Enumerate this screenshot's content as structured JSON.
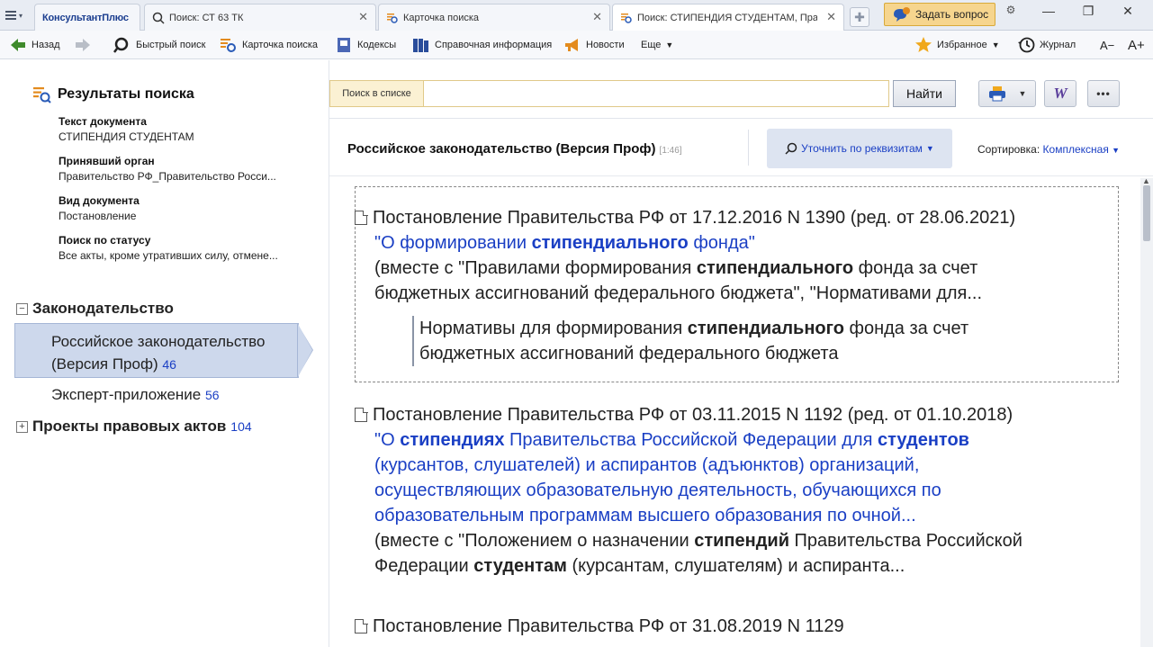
{
  "app": {
    "logo": "КонсультантПлюс"
  },
  "tabs": [
    {
      "label": "Поиск: СТ 63 ТК"
    },
    {
      "label": "Карточка поиска"
    },
    {
      "label": "Поиск: СТИПЕНДИЯ СТУДЕНТАМ, Прави"
    }
  ],
  "ask_button": "Задать вопрос",
  "toolbar": {
    "back": "Назад",
    "quick_search": "Быстрый поиск",
    "search_card": "Карточка поиска",
    "codes": "Кодексы",
    "reference": "Справочная информация",
    "news": "Новости",
    "more": "Еще",
    "favorites": "Избранное",
    "journal": "Журнал",
    "font_smaller": "A−",
    "font_larger": "A+"
  },
  "left": {
    "title": "Результаты поиска",
    "criteria": [
      {
        "key": "Текст документа",
        "value": "СТИПЕНДИЯ СТУДЕНТАМ"
      },
      {
        "key": "Принявший орган",
        "value": "Правительство РФ_Правительство Росси..."
      },
      {
        "key": "Вид документа",
        "value": "Постановление"
      },
      {
        "key": "Поиск по статусу",
        "value": "Все акты, кроме утративших силу, отмене..."
      }
    ],
    "tree": {
      "legislation": "Законодательство",
      "selected_label": "Российское законодательство (Версия Проф)",
      "selected_count": "46",
      "expert_label": "Эксперт-приложение",
      "expert_count": "56",
      "projects_label": "Проекты правовых актов",
      "projects_count": "104"
    }
  },
  "search": {
    "label": "Поиск в списке",
    "value": "",
    "placeholder": "",
    "button": "Найти"
  },
  "results": {
    "header_title": "Российское законодательство (Версия Проф)",
    "header_range": "[1:46]",
    "refine_button": "Уточнить по реквизитам",
    "sort_label": "Сортировка:",
    "sort_value": "Комплексная",
    "docs": [
      {
        "head": "Постановление Правительства РФ от 17.12.2016 N 1390 (ред. от 28.06.2021)",
        "title_a": "\"О формировании ",
        "title_b": "стипендиального",
        "title_c": " фонда\"",
        "note_a": "(вместе с \"Правилами формирования ",
        "note_b": "стипендиального",
        "note_c": " фонда за счет бюджетных ассигнований федерального бюджета\", \"Нормативами для...",
        "quote_a": "Нормативы для формирования ",
        "quote_b": "стипендиального",
        "quote_c": " фонда за счет бюджетных ассигнований федерального бюджета"
      },
      {
        "head": "Постановление Правительства РФ от 03.11.2015 N 1192 (ред. от 01.10.2018)",
        "title_a": "\"О ",
        "title_b": "стипендиях",
        "title_c": " Правительства Российской Федерации для ",
        "title_d": "студентов",
        "title_e": " (курсантов, слушателей) и аспирантов (адъюнктов) организаций, осуществляющих образовательную деятельность, обучающихся по образовательным программам высшего образования по очной...",
        "note_a": "(вместе с \"Положением о назначении ",
        "note_b": "стипендий",
        "note_c": " Правительства Российской Федерации ",
        "note_d": "студентам",
        "note_e": " (курсантам, слушателям) и аспиранта..."
      },
      {
        "head": "Постановление Правительства РФ от 31.08.2019 N 1129"
      }
    ]
  },
  "colors": {
    "link": "#1a3fc4",
    "accent": "#f6d58e",
    "selected": "#cdd8ec"
  }
}
